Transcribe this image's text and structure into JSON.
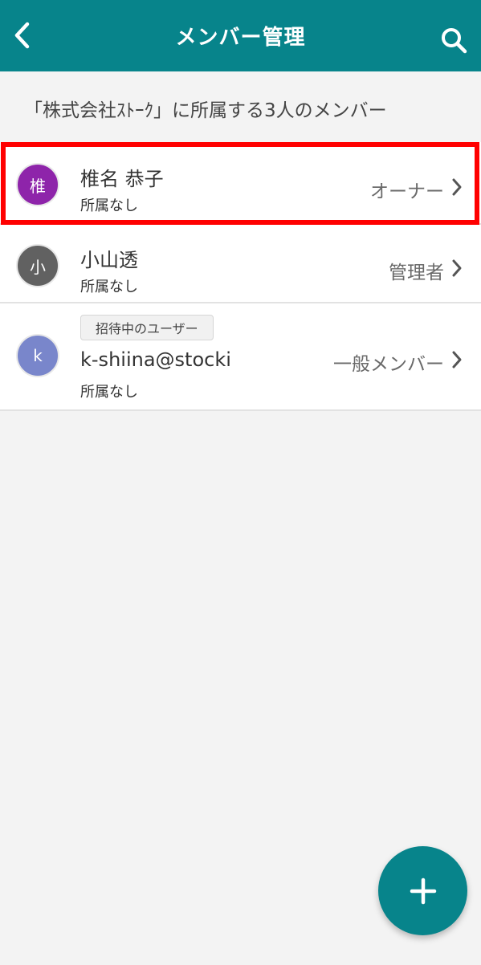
{
  "header": {
    "title": "メンバー管理",
    "back_icon": "chevron-left-icon",
    "search_icon": "search-icon",
    "bg_color": "#07848b"
  },
  "subtitle": "「株式会社ｽﾄｰｸ」に所属する3人のメンバー",
  "members": [
    {
      "initial": "椎",
      "name": "椎名 恭子",
      "org": "所属なし",
      "role": "オーナー",
      "avatar_color": "#8e24aa",
      "selected": true
    },
    {
      "initial": "小",
      "name": "小山透",
      "org": "所属なし",
      "role": "管理者",
      "avatar_color": "#616161"
    },
    {
      "initial": "k",
      "badge": "招待中のユーザー",
      "name": "k-shiina@stocki",
      "org": "所属なし",
      "role": "一般メンバー",
      "avatar_color": "#7986cb"
    }
  ],
  "fab": {
    "icon": "plus-icon"
  },
  "colors": {
    "highlight": "#ff0000",
    "accent": "#07848b"
  }
}
